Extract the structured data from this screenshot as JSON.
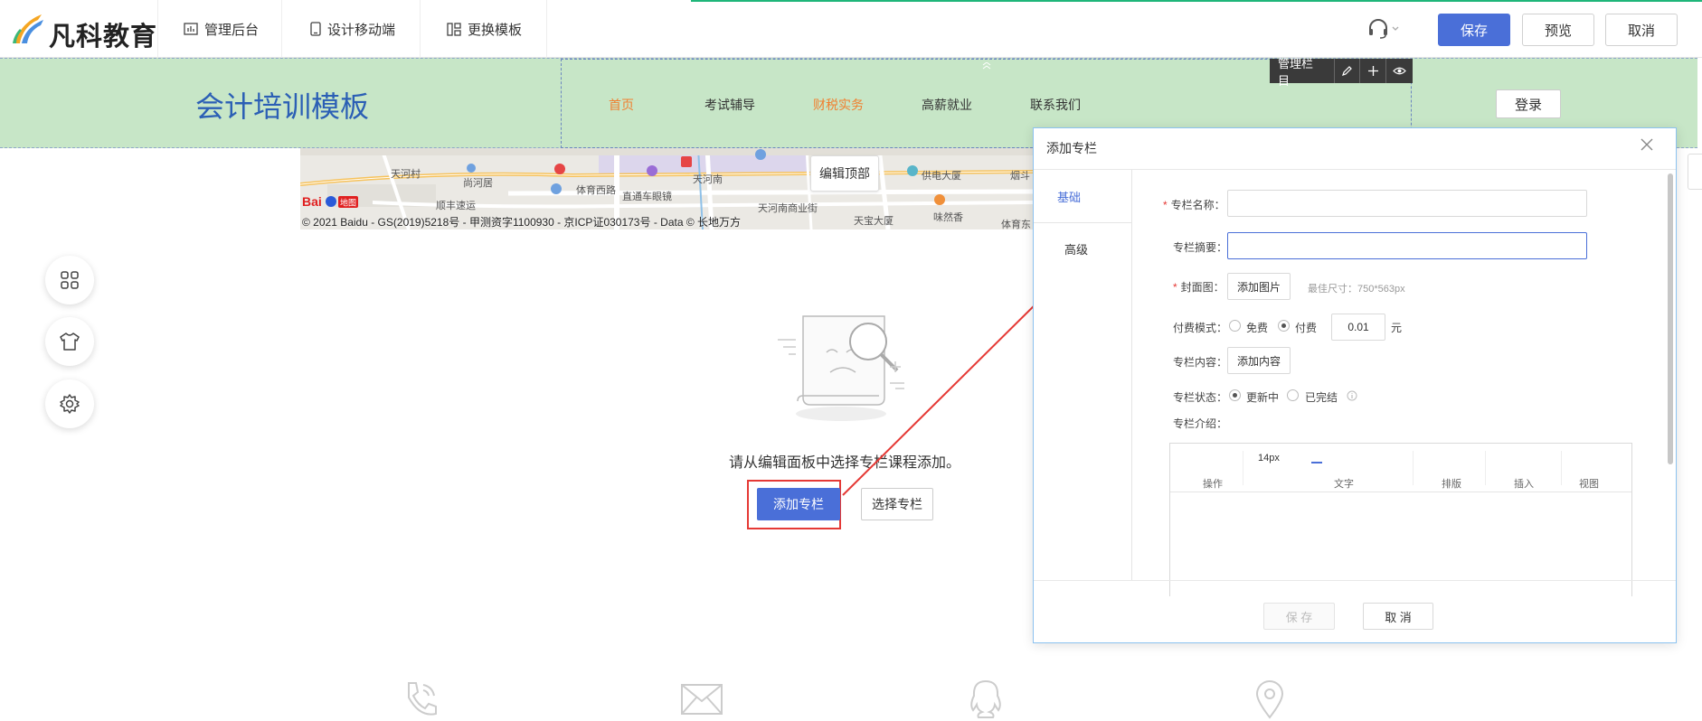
{
  "brand": {
    "name": "凡科教育"
  },
  "topbar": {
    "nav": [
      {
        "label": "管理后台",
        "icon": "chart-board-icon"
      },
      {
        "label": "设计移动端",
        "icon": "mobile-icon"
      },
      {
        "label": "更换模板",
        "icon": "template-icon"
      }
    ],
    "support_icon": "headset-icon",
    "save_label": "保存",
    "preview_label": "预览",
    "cancel_label": "取消",
    "accent_color": "#4a6fd8"
  },
  "header": {
    "site_title": "会计培训模板",
    "nav": [
      {
        "label": "首页",
        "active": true
      },
      {
        "label": "考试辅导",
        "active": false
      },
      {
        "label": "财税实务",
        "active": true
      },
      {
        "label": "高薪就业",
        "active": false
      },
      {
        "label": "联系我们",
        "active": false
      }
    ],
    "manage_bar": {
      "label": "管理栏目",
      "icons": [
        "edit-icon",
        "plus-icon",
        "eye-icon"
      ]
    },
    "login_label": "登录",
    "band_color": "#c7e6c7"
  },
  "map": {
    "labels": [
      "天河村",
      "尚河居",
      "体育西路",
      "天河南",
      "供电大厦",
      "顺丰速运",
      "直通车眼镜",
      "天河南商业街",
      "天宝大厦",
      "味然香",
      "体育东",
      "烟斗"
    ],
    "logo_text": "Baidu地图",
    "copyright": "© 2021 Baidu - GS(2019)5218号 - 甲测资字1100930 - 京ICP证030173号 - Data © 长地万方"
  },
  "edit_top_label": "编辑顶部",
  "side_tools": [
    "grid-icon",
    "tshirt-icon",
    "gear-icon"
  ],
  "empty_state": {
    "icon": "empty-document-search-icon",
    "text": "请从编辑面板中选择专栏课程添加。",
    "add_label": "添加专栏",
    "select_label": "选择专栏"
  },
  "footer_icons": [
    "phone-icon",
    "mail-icon",
    "qq-icon",
    "location-icon"
  ],
  "dialog": {
    "title": "添加专栏",
    "tabs": [
      "基础",
      "高级"
    ],
    "fields": {
      "name_label": "专栏名称：",
      "name_value": "",
      "summary_label": "专栏摘要：",
      "summary_value": "",
      "cover_label": "封面图：",
      "cover_button": "添加图片",
      "cover_hint": "最佳尺寸：750*563px",
      "pay_label": "付费模式：",
      "pay_options": [
        "免费",
        "付费"
      ],
      "pay_selected": "付费",
      "price_value": "0.01",
      "price_unit": "元",
      "content_label": "专栏内容：",
      "content_button": "添加内容",
      "status_label": "专栏状态：",
      "status_options": [
        "更新中",
        "已完结"
      ],
      "status_selected": "更新中",
      "intro_label": "专栏介绍："
    },
    "editor": {
      "font_size": "14px",
      "groups": [
        "操作",
        "文字",
        "排版",
        "插入",
        "视图"
      ]
    },
    "save_label": "保 存",
    "cancel_label": "取 消"
  }
}
